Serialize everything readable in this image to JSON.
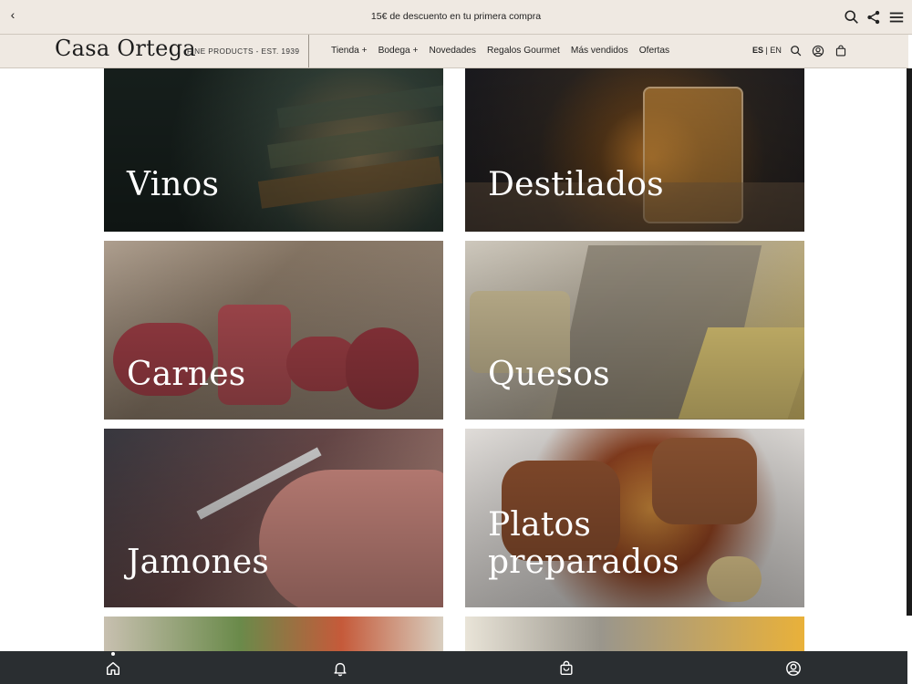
{
  "topbar": {
    "promo_text": "15€ de descuento en tu primera compra",
    "back_glyph": "‹",
    "icons": [
      "back-chevron-icon",
      "search-icon",
      "share-icon",
      "menu-icon"
    ]
  },
  "header": {
    "brand": "Casa Ortega",
    "tagline": "FINE PRODUCTS - EST. 1939",
    "nav": [
      "Tienda +",
      "Bodega +",
      "Novedades",
      "Regalos Gourmet",
      "Más vendidos",
      "Ofertas"
    ],
    "lang_active": "ES",
    "lang_sep": "|",
    "lang_other": "EN",
    "icons": [
      "search-icon",
      "account-icon",
      "cart-icon"
    ]
  },
  "categories": [
    {
      "label": "Vinos"
    },
    {
      "label": "Destilados"
    },
    {
      "label": "Carnes"
    },
    {
      "label": "Quesos"
    },
    {
      "label": "Jamones"
    },
    {
      "label_line1": "Platos",
      "label_line2": "preparados"
    }
  ],
  "tabbar": {
    "tabs": [
      "home-icon",
      "bell-icon",
      "cart-icon",
      "account-icon"
    ],
    "active_tab": "home"
  },
  "colors": {
    "header_bg": "#efe9e2",
    "tabbar_bg": "#2a2e31",
    "label_text": "#ffffff"
  }
}
